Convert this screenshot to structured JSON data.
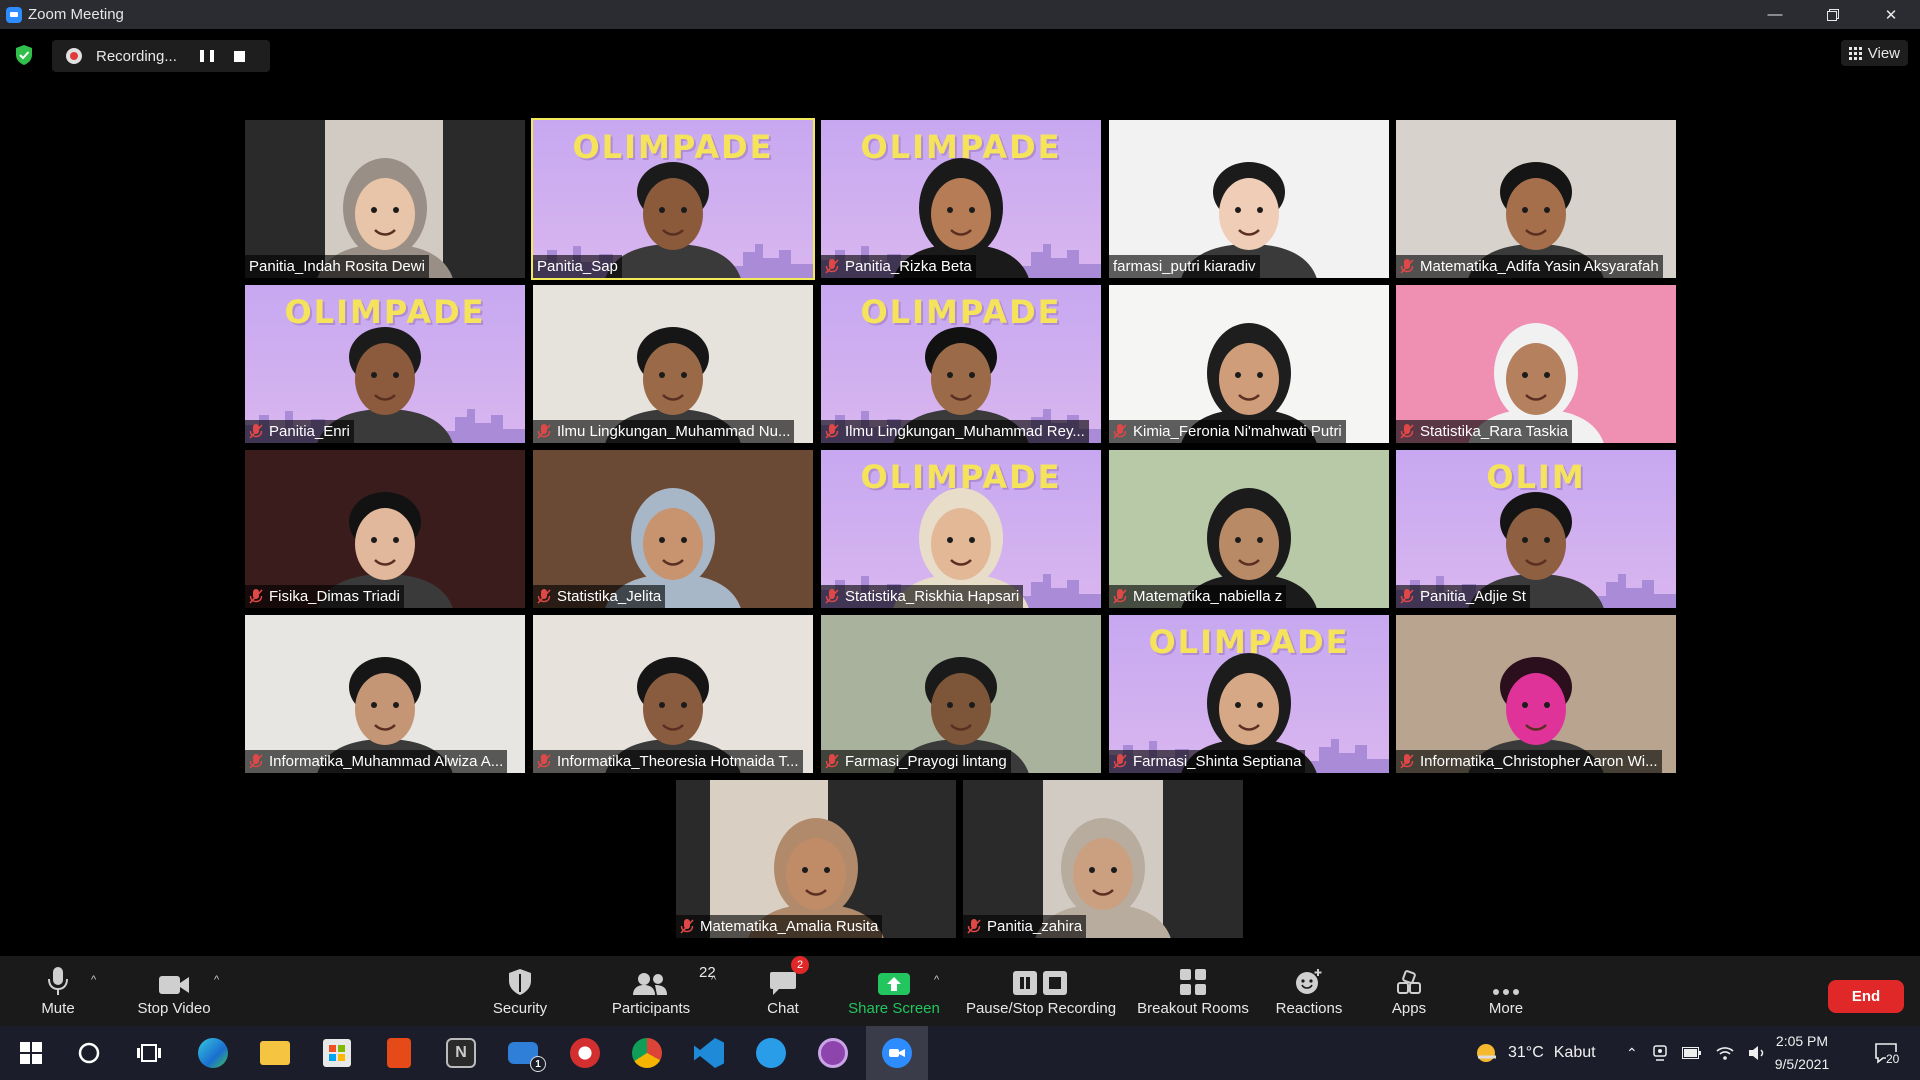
{
  "window": {
    "title": "Zoom Meeting"
  },
  "recording": {
    "label": "Recording..."
  },
  "view_button": {
    "label": "View"
  },
  "tiles": [
    {
      "name": "Panitia_Indah Rosita Dewi",
      "muted": false,
      "bg": "#2a2a2a",
      "mode": "portrait",
      "skin": "#e8c5a8",
      "hijab": "#9a8f86"
    },
    {
      "name": "Panitia_Sap",
      "muted": false,
      "bg": "#c9a6ef",
      "mode": "banner",
      "banner": "OLIMPADE",
      "skin": "#8a5a3a",
      "hair": "#1b1b1b",
      "active": true
    },
    {
      "name": "Panitia_Rizka Beta",
      "muted": true,
      "bg": "#c9a6ef",
      "mode": "banner",
      "banner": "OLIMPADE",
      "skin": "#b57c55",
      "hijab": "#1a1a1a"
    },
    {
      "name": "farmasi_putri kiaradiv",
      "muted": false,
      "bg": "#f2f2f2",
      "mode": "full",
      "skin": "#f0cdb6",
      "hair": "#1b1b1b"
    },
    {
      "name": "Matematika_Adifa Yasin Aksyarafah",
      "muted": true,
      "bg": "#d7d2cc",
      "mode": "full",
      "skin": "#a56f4c",
      "hair": "#151515"
    },
    {
      "name": "Panitia_Enri",
      "muted": true,
      "bg": "#c9a6ef",
      "mode": "banner",
      "banner": "OLIMPADE",
      "skin": "#8c5a3c",
      "hair": "#1b1b1b"
    },
    {
      "name": "Ilmu Lingkungan_Muhammad Nu...",
      "muted": true,
      "bg": "#e6e2dc",
      "mode": "full",
      "skin": "#9a6a48",
      "hair": "#161616"
    },
    {
      "name": "Ilmu Lingkungan_Muhammad Rey...",
      "muted": true,
      "bg": "#c9a6ef",
      "mode": "banner",
      "banner": "OLIMPADE",
      "skin": "#9b6a48",
      "hair": "#111"
    },
    {
      "name": "Kimia_Feronia Ni'mahwati Putri",
      "muted": true,
      "bg": "#f5f5f3",
      "mode": "full",
      "skin": "#cf9d79",
      "hijab": "#1e1e1e"
    },
    {
      "name": "Statistika_Rara Taskia",
      "muted": true,
      "bg": "#ef8fb2",
      "mode": "full",
      "skin": "#b5805d",
      "hijab": "#f1f1f1"
    },
    {
      "name": "Fisika_Dimas Triadi",
      "muted": true,
      "bg": "#3a1c1c",
      "mode": "full",
      "skin": "#e1b89c",
      "hair": "#121212"
    },
    {
      "name": "Statistika_Jelita",
      "muted": true,
      "bg": "#6b4a35",
      "mode": "full",
      "skin": "#c7946f",
      "hijab": "#a7b7c8"
    },
    {
      "name": "Statistika_Riskhia Hapsari",
      "muted": true,
      "bg": "#c9a6ef",
      "mode": "banner",
      "banner": "OLIMPADE",
      "skin": "#e2b897",
      "hijab": "#e8ddc8"
    },
    {
      "name": "Matematika_nabiella z",
      "muted": true,
      "bg": "#b8c9a8",
      "mode": "full",
      "skin": "#b88a66",
      "hijab": "#1b1b1b"
    },
    {
      "name": "Panitia_Adjie St",
      "muted": true,
      "bg": "#c9a6ef",
      "mode": "banner",
      "banner": "OLIM",
      "skin": "#8f5f42",
      "hair": "#141414"
    },
    {
      "name": "Informatika_Muhammad Alwiza A...",
      "muted": true,
      "bg": "#e8e6e2",
      "mode": "full",
      "skin": "#c49676",
      "hair": "#161616"
    },
    {
      "name": "Informatika_Theoresia Hotmaida T...",
      "muted": true,
      "bg": "#e7e3dc",
      "mode": "full",
      "skin": "#8a5c3f",
      "hair": "#151515"
    },
    {
      "name": "Farmasi_Prayogi lintang",
      "muted": true,
      "bg": "#a8b29c",
      "mode": "full",
      "skin": "#7d5538",
      "hair": "#1a1a1a"
    },
    {
      "name": "Farmasi_Shinta Septiana",
      "muted": true,
      "bg": "#c9a6ef",
      "mode": "banner",
      "banner": "OLIMPADE",
      "skin": "#d7a885",
      "hijab": "#1c1c1c"
    },
    {
      "name": "Informatika_Christopher Aaron Wi...",
      "muted": true,
      "bg": "#b9a58f",
      "mode": "full",
      "skin": "#e0339a",
      "hair": "#2b0f1d"
    },
    {
      "name": "Matematika_Amalia Rusita",
      "muted": true,
      "bg": "#2a2a2a",
      "mode": "portrait",
      "skin": "#c08c68",
      "hijab": "#b08a6a"
    },
    {
      "name": "Panitia_zahira",
      "muted": true,
      "bg": "#2a2a2a",
      "mode": "portrait-narrow",
      "skin": "#caa080",
      "hijab": "#b7ac9e"
    }
  ],
  "toolbar": {
    "mute": "Mute",
    "stop_video": "Stop Video",
    "security": "Security",
    "participants": "Participants",
    "participants_count": "22",
    "chat": "Chat",
    "chat_badge": "2",
    "share_screen": "Share Screen",
    "pause_stop_recording": "Pause/Stop Recording",
    "breakout_rooms": "Breakout Rooms",
    "reactions": "Reactions",
    "apps": "Apps",
    "more": "More",
    "end": "End",
    "share_color": "#22c55e"
  },
  "taskbar": {
    "weather_temp": "31°C",
    "weather_desc": "Kabut",
    "time": "2:05 PM",
    "date": "9/5/2021",
    "notification_count": "20",
    "mail_badge": "1",
    "apps": [
      "start-icon",
      "cortana-icon",
      "task-view-icon",
      "edge-icon",
      "file-explorer-icon",
      "store-icon",
      "office-icon",
      "notion-icon",
      "mail-icon",
      "chrome-red-icon",
      "chrome-icon",
      "vscode-icon",
      "mic-app-icon",
      "github-icon",
      "zoom-icon"
    ]
  }
}
